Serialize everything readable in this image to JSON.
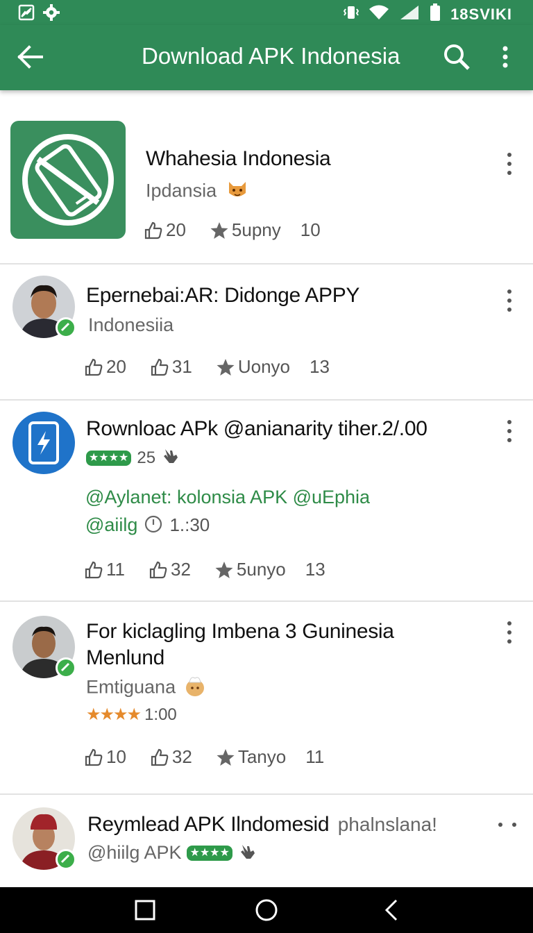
{
  "status_bar": {
    "time": "18SVIKI"
  },
  "app_bar": {
    "title": "Download APK Indonesia"
  },
  "items": [
    {
      "title": "Whahesia Indonesia",
      "subtitle": "Ipdansia",
      "stats": [
        {
          "icon": "thumbs-up-icon",
          "value": "20"
        },
        {
          "icon": "star-icon",
          "value": "5upny"
        },
        {
          "icon": "",
          "value": "10"
        }
      ]
    },
    {
      "title": "Epernebai:AR:  Didonge APPY",
      "subtitle": "Indonesiia",
      "stats": [
        {
          "icon": "thumbs-up-icon",
          "value": "20"
        },
        {
          "icon": "thumbs-up-icon",
          "value": "31"
        },
        {
          "icon": "star-icon",
          "value": "Uonyo"
        },
        {
          "icon": "",
          "value": "13"
        }
      ]
    },
    {
      "title": "Rownloac APk  @anianarity tiher.2/.00",
      "rating_count": "25",
      "green_line_1": "@Aylanet: kolonsia  APK @uEphia",
      "green_line_2": "@aiilg",
      "time_text": "1.:30",
      "stats": [
        {
          "icon": "thumbs-up-icon",
          "value": "11"
        },
        {
          "icon": "thumbs-up-icon",
          "value": "32"
        },
        {
          "icon": "star-icon",
          "value": "5unyo"
        },
        {
          "icon": "",
          "value": "13"
        }
      ]
    },
    {
      "title_line_1": "For kiclagling Imbena 3 Guninesia",
      "title_line_2": "Menlund",
      "subtitle": "Emtiguana",
      "rating_value": "1:00",
      "stats": [
        {
          "icon": "thumbs-up-icon",
          "value": "10"
        },
        {
          "icon": "thumbs-up-icon",
          "value": "32"
        },
        {
          "icon": "star-icon",
          "value": "Tanyo"
        },
        {
          "icon": "",
          "value": "11"
        }
      ]
    },
    {
      "title": "Reymlead APK Ilndomesid",
      "title_suffix": "phalnslana!",
      "subtitle": "@hiilg APK"
    }
  ],
  "colors": {
    "primary": "#2f8a57",
    "accent_green": "#2e8b47",
    "star_orange": "#e58a2c",
    "app_icon_bg": "#3a8f5e",
    "blue_icon_bg": "#1f73c9"
  }
}
